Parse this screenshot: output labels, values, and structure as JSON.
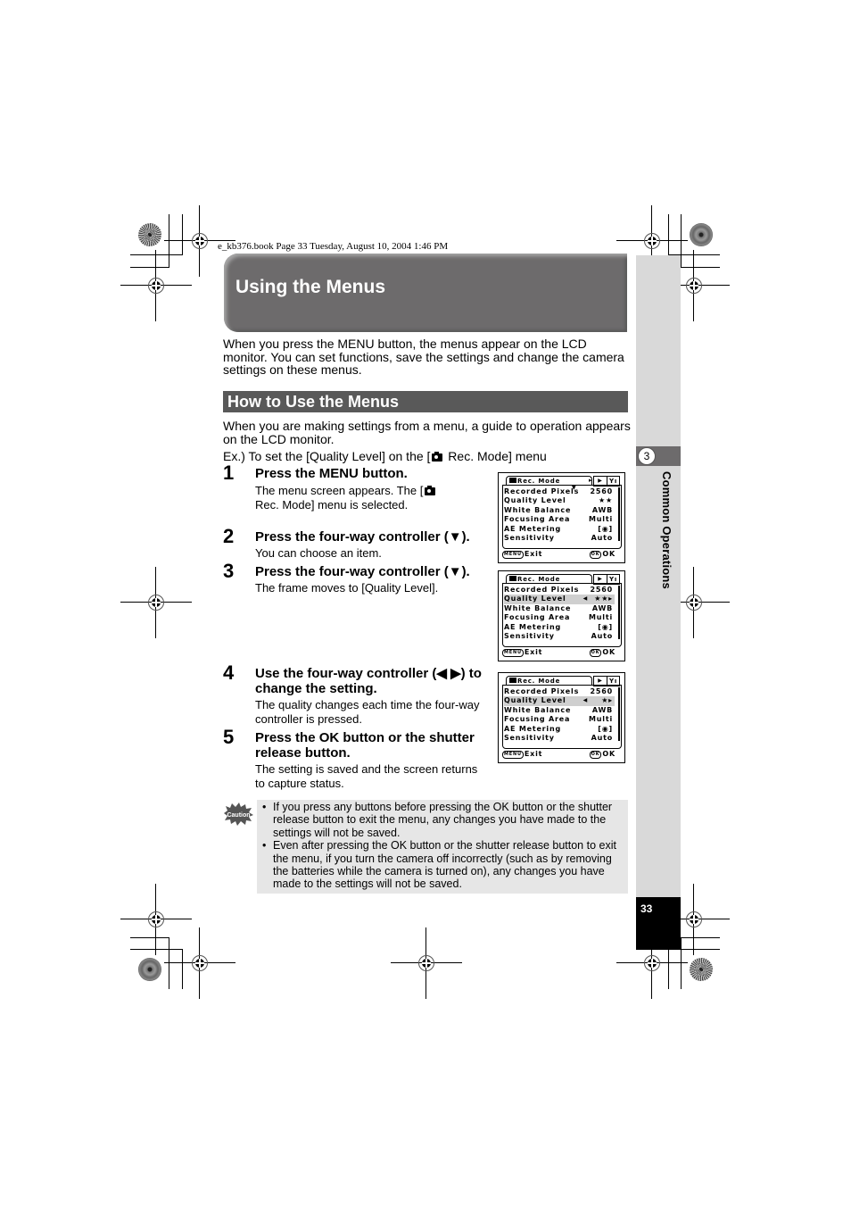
{
  "print_header": "e_kb376.book  Page 33  Tuesday, August 10, 2004  1:46 PM",
  "page_title": "Using the Menus",
  "intro": "When you press the MENU button, the menus appear on the LCD monitor. You can set functions, save the settings and change the camera settings on these menus.",
  "section_heading": "How to Use the Menus",
  "guide_text": "When you are making settings from a menu, a guide to operation appears on the LCD monitor.",
  "example": {
    "prefix": "Ex.) To set the [Quality Level] on the [",
    "suffix": " Rec. Mode] menu",
    "icon": "camera-icon"
  },
  "steps": [
    {
      "number": "1",
      "title": "Press the MENU button.",
      "desc_pre": "The menu screen appears. The [",
      "desc_post": " Rec. Mode] menu is selected."
    },
    {
      "number": "2",
      "title": "Press the four-way controller (▼).",
      "desc": "You can choose an item."
    },
    {
      "number": "3",
      "title": "Press the four-way controller (▼).",
      "desc": "The frame moves to [Quality Level]."
    },
    {
      "number": "4",
      "title": "Use the four-way controller (◀ ▶) to change the setting.",
      "desc": "The quality changes each time the four-way controller is pressed."
    },
    {
      "number": "5",
      "title": "Press the OK button or the shutter release button.",
      "desc": "The setting is saved and the screen returns to capture status."
    }
  ],
  "lcd_screens": [
    {
      "tab_label": "Rec. Mode",
      "tab2": "▶",
      "tab3": "Yı",
      "items": [
        {
          "label": "Recorded Pixels",
          "value": "2560"
        },
        {
          "label": "Quality Level",
          "value": "★★"
        },
        {
          "label": "White Balance",
          "value": "AWB"
        },
        {
          "label": "Focusing Area",
          "value": "Multi"
        },
        {
          "label": "AE Metering",
          "value": "[◉]"
        },
        {
          "label": "Sensitivity",
          "value": "Auto"
        }
      ],
      "selected": -1,
      "footer_left_key": "MENU",
      "footer_left": "Exit",
      "footer_right_key": "OK",
      "footer_right": "OK"
    },
    {
      "tab_label": "Rec. Mode",
      "tab2": "▶",
      "tab3": "Yı",
      "items": [
        {
          "label": "Recorded Pixels",
          "value": "2560"
        },
        {
          "label": "Quality Level",
          "value": "★★▸"
        },
        {
          "label": "White Balance",
          "value": "AWB"
        },
        {
          "label": "Focusing Area",
          "value": "Multi"
        },
        {
          "label": "AE Metering",
          "value": "[◉]"
        },
        {
          "label": "Sensitivity",
          "value": "Auto"
        }
      ],
      "selected": 1,
      "footer_left_key": "MENU",
      "footer_left": "Exit",
      "footer_right_key": "OK",
      "footer_right": "OK"
    },
    {
      "tab_label": "Rec. Mode",
      "tab2": "▶",
      "tab3": "Yı",
      "items": [
        {
          "label": "Recorded Pixels",
          "value": "2560"
        },
        {
          "label": "Quality Level",
          "value": "★▸"
        },
        {
          "label": "White Balance",
          "value": "AWB"
        },
        {
          "label": "Focusing Area",
          "value": "Multi"
        },
        {
          "label": "AE Metering",
          "value": "[◉]"
        },
        {
          "label": "Sensitivity",
          "value": "Auto"
        }
      ],
      "selected": 1,
      "footer_left_key": "MENU",
      "footer_left": "Exit",
      "footer_right_key": "OK",
      "footer_right": "OK"
    }
  ],
  "caution": {
    "icon_label": "Caution",
    "items": [
      "If you press any buttons before pressing the OK button or the shutter release button to exit the menu, any changes you have made to the settings will not be saved.",
      "Even after pressing the OK button or the shutter release button to exit the menu, if you turn the camera off incorrectly (such as by removing the batteries while the camera is turned on), any changes you have made to the settings will not be saved."
    ]
  },
  "chapter": {
    "number": "3",
    "label": "Common Operations"
  },
  "page_number": "33",
  "colors": {
    "title_bg": "#6d6b6c",
    "section_bg": "#595959",
    "side_band": "#d9d9d9",
    "caution_bg": "#e6e6e6"
  }
}
